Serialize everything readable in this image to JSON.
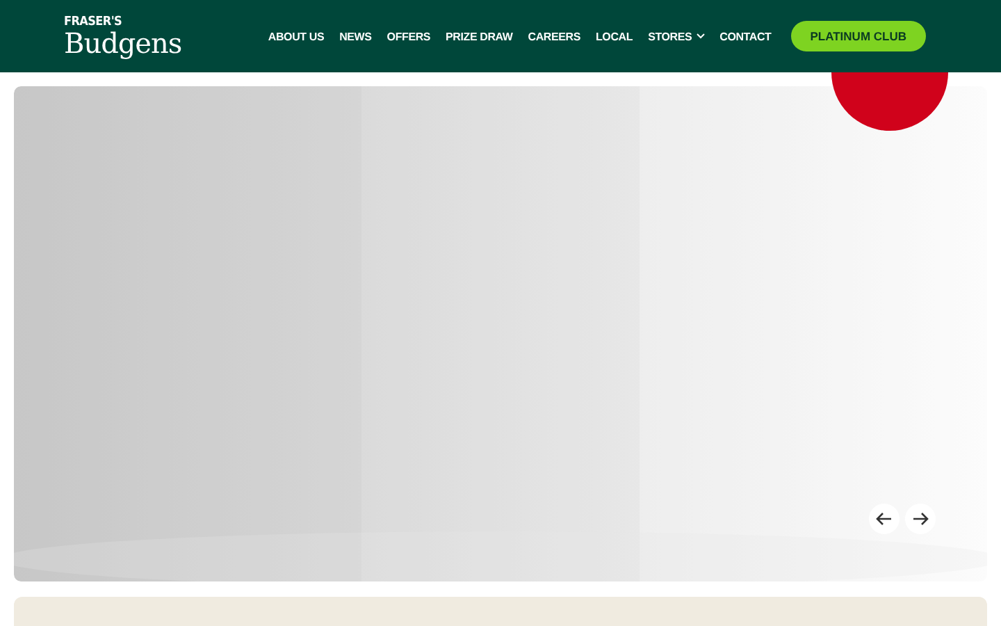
{
  "logo": {
    "small": "FRASER'S",
    "large": "Budgens"
  },
  "nav": [
    {
      "label": "ABOUT US"
    },
    {
      "label": "NEWS"
    },
    {
      "label": "OFFERS"
    },
    {
      "label": "PRIZE DRAW"
    },
    {
      "label": "CAREERS"
    },
    {
      "label": "LOCAL"
    },
    {
      "label": "STORES",
      "dropdown": true
    },
    {
      "label": "CONTACT"
    }
  ],
  "cta": "PLATINUM CLUB"
}
